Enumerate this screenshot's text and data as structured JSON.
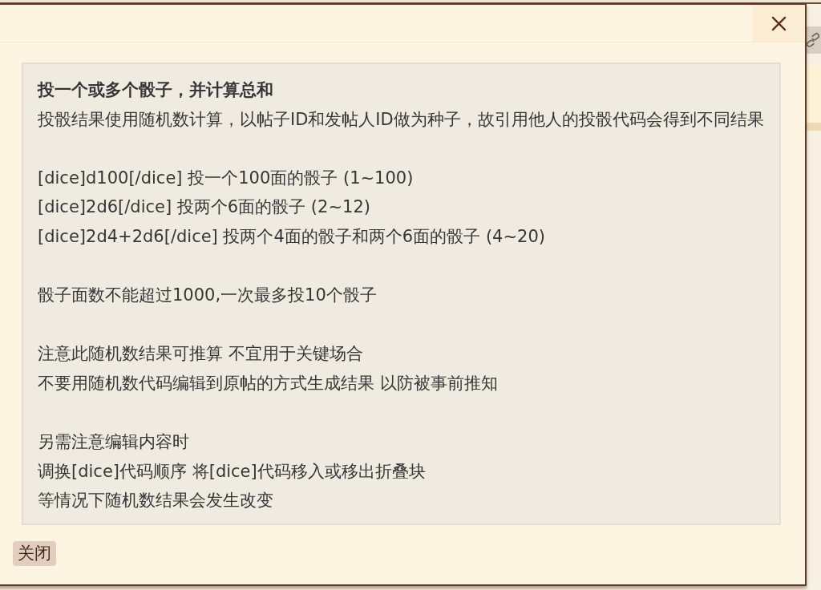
{
  "dialog": {
    "content": {
      "title": "投一个或多个骰子，并计算总和",
      "sections": [
        {
          "lines": [
            "投骰结果使用随机数计算，以帖子ID和发帖人ID做为种子，故引用他人的投骰代码会得到不同结果"
          ]
        },
        {
          "lines": [
            "[dice]d100[/dice] 投一个100面的骰子 (1~100)",
            "[dice]2d6[/dice] 投两个6面的骰子 (2~12)",
            "[dice]2d4+2d6[/dice] 投两个4面的骰子和两个6面的骰子 (4~20)"
          ]
        },
        {
          "lines": [
            "骰子面数不能超过1000,一次最多投10个骰子"
          ]
        },
        {
          "lines": [
            "注意此随机数结果可推算 不宜用于关键场合",
            "不要用随机数代码编辑到原帖的方式生成结果 以防被事前推知"
          ]
        },
        {
          "lines": [
            "另需注意编辑内容时",
            "调换[dice]代码顺序 将[dice]代码移入或移出折叠块",
            "等情况下随机数结果会发生改变"
          ]
        }
      ]
    },
    "buttons": [
      {
        "label": "关闭"
      }
    ]
  }
}
